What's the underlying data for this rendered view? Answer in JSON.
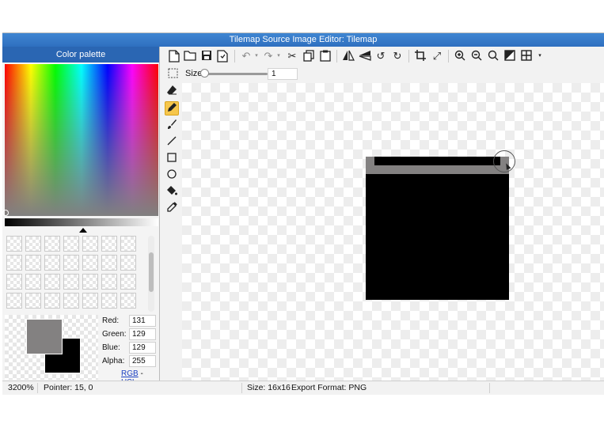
{
  "window": {
    "title": "Tilemap Source Image Editor: Tilemap"
  },
  "palette": {
    "header": "Color palette",
    "foreground_color": "#838181",
    "background_color": "#000000",
    "red_label": "Red:",
    "red_value": "131",
    "green_label": "Green:",
    "green_value": "129",
    "blue_label": "Blue:",
    "blue_value": "129",
    "alpha_label": "Alpha:",
    "alpha_value": "255",
    "rgb_link": "RGB",
    "separator": "-",
    "hsl_link": "HSL"
  },
  "toolbar": {
    "icons": [
      "new-file-icon",
      "open-folder-icon",
      "save-icon",
      "save-as-icon",
      "undo-icon",
      "redo-icon",
      "cut-icon",
      "copy-icon",
      "paste-icon",
      "flip-horizontal-icon",
      "flip-vertical-icon",
      "rotate-left-icon",
      "rotate-right-icon",
      "crop-icon",
      "resize-icon",
      "zoom-in-icon",
      "zoom-out-icon",
      "zoom-fit-icon",
      "invert-icon",
      "grid-icon"
    ]
  },
  "size_bar": {
    "label": "Size",
    "value": "1",
    "slider_fraction": 0.0
  },
  "tools": [
    "select-icon",
    "eraser-icon",
    "pencil-icon",
    "brush-icon",
    "line-icon",
    "rectangle-icon",
    "ellipse-icon",
    "fill-bucket-icon",
    "eyedropper-icon"
  ],
  "active_tool": "pencil-icon",
  "status": {
    "zoom": "3200%",
    "pointer": "Pointer: 15, 0",
    "size": "Size: 16x16",
    "export_format": "Export Format: PNG"
  }
}
